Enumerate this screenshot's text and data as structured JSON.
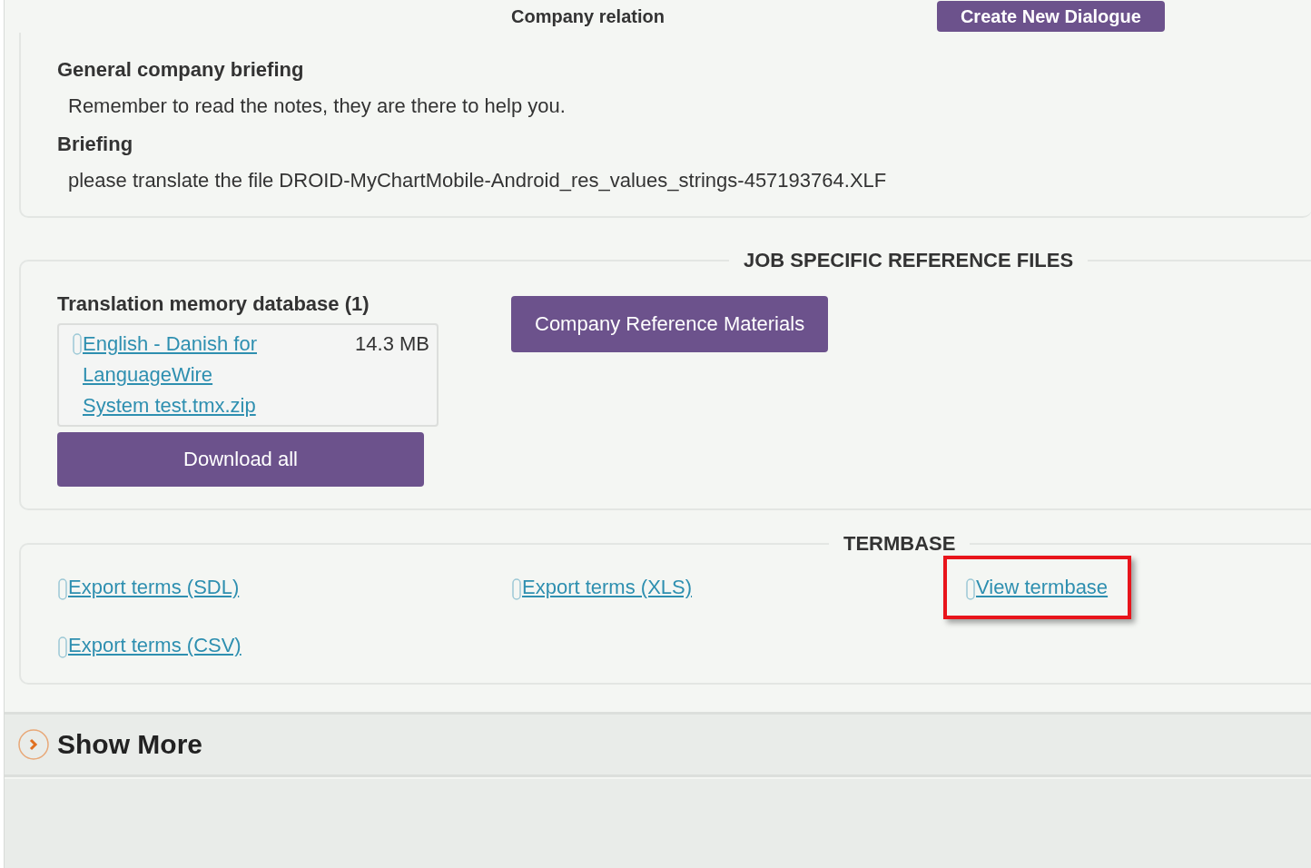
{
  "header": {
    "title": "Company relation",
    "button": "Create New Dialogue"
  },
  "briefings": [
    {
      "title": "General company briefing",
      "text": "Remember to read the notes, they are there to help you."
    },
    {
      "title": "Briefing",
      "text": "please translate the file DROID-MyChartMobile-Android_res_values_strings-457193764.XLF"
    }
  ],
  "reference_files": {
    "legend": "JOB SPECIFIC REFERENCE FILES",
    "tm_title": "Translation memory database (1)",
    "files": [
      {
        "name": "English - Danish for LanguageWire System test.tmx.zip",
        "size": "14.3 MB"
      }
    ],
    "download_button": "Download all",
    "company_button": "Company Reference Materials"
  },
  "termbase": {
    "legend": "TERMBASE",
    "links": [
      {
        "label": "Export terms (SDL)",
        "highlighted": false
      },
      {
        "label": "Export terms (XLS)",
        "highlighted": false
      },
      {
        "label": "View termbase",
        "highlighted": true
      },
      {
        "label": "Export terms (CSV)",
        "highlighted": false
      }
    ]
  },
  "sections": [
    {
      "label": "Show More",
      "expanded": false
    }
  ]
}
